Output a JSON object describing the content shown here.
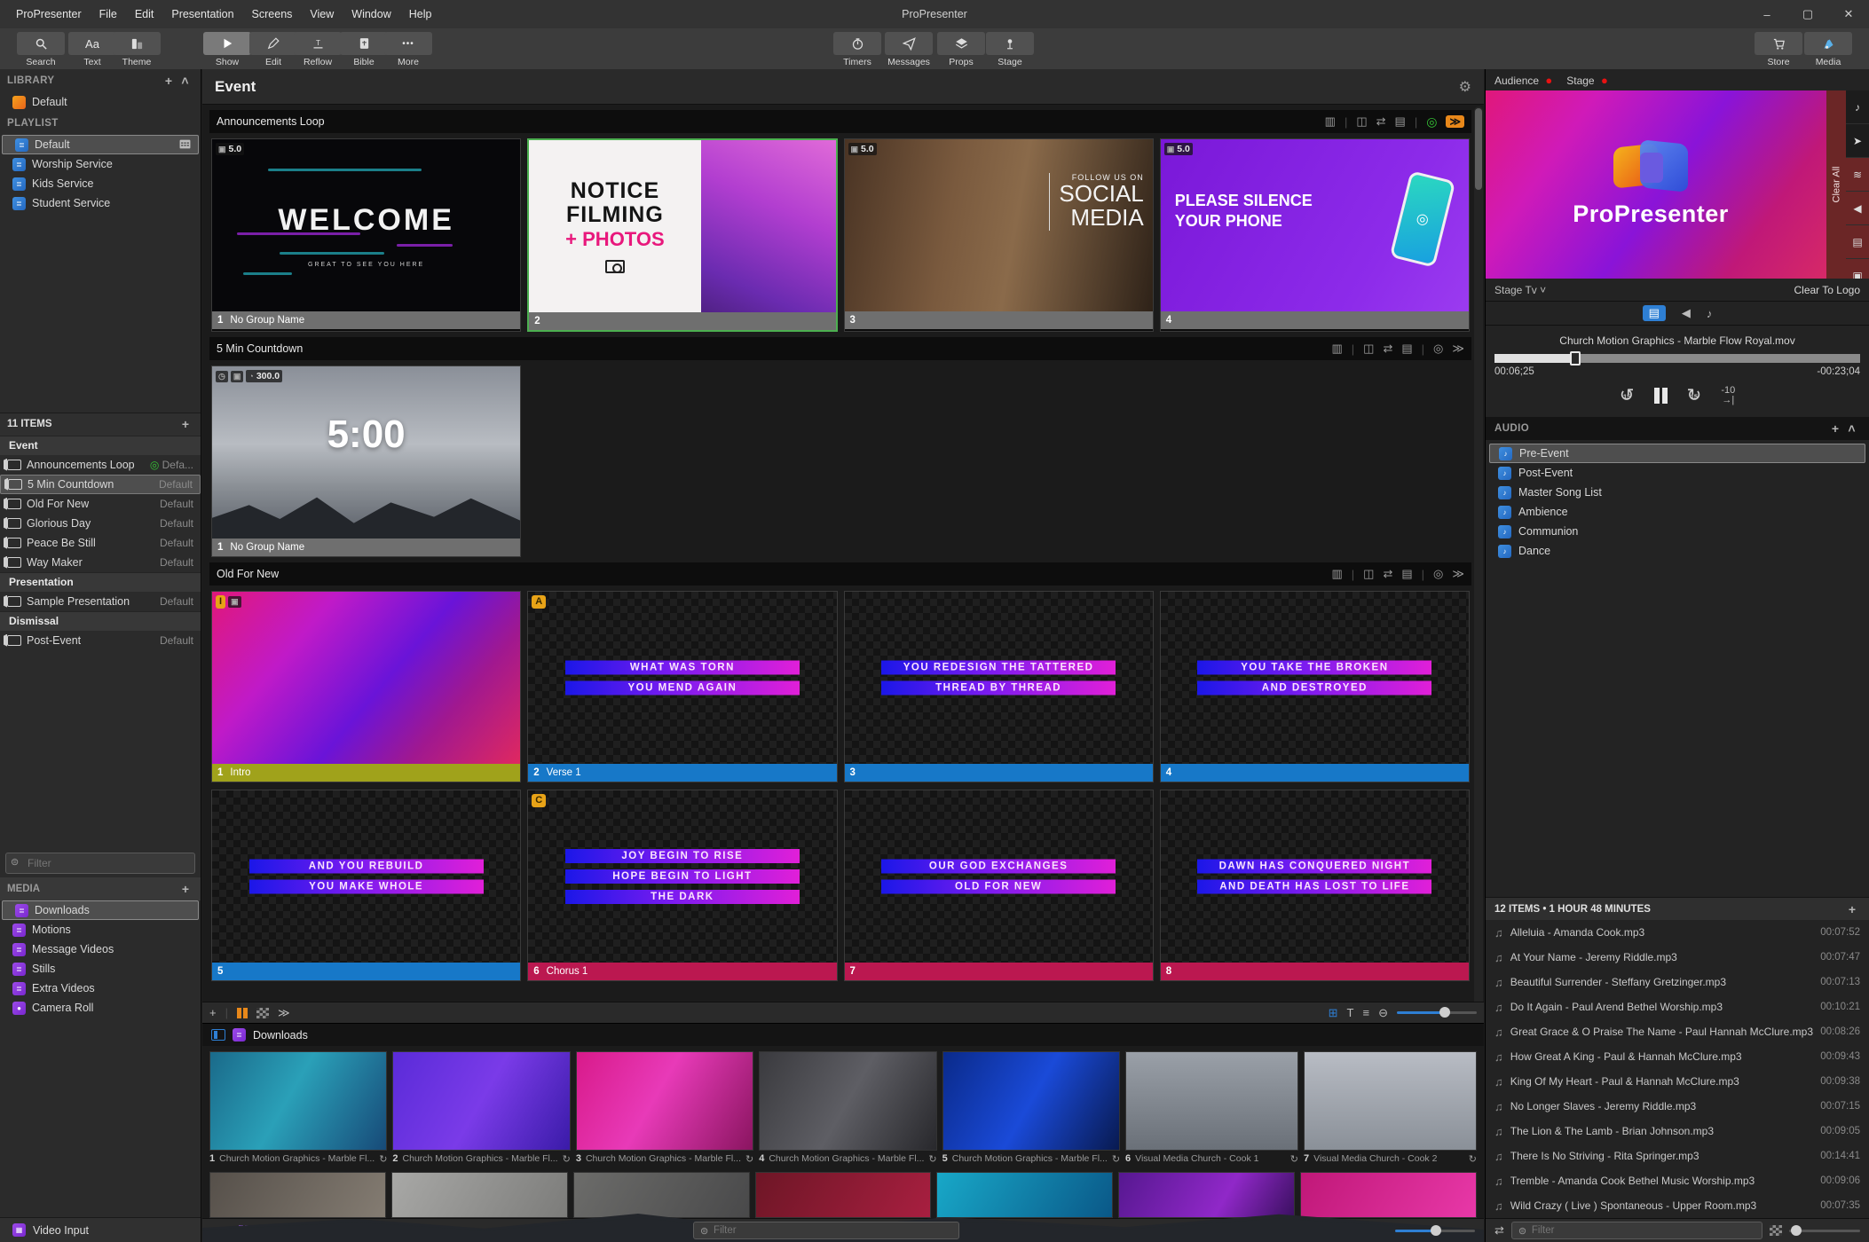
{
  "window": {
    "title": "ProPresenter",
    "minimize": "–",
    "maximize": "▢",
    "close": "✕"
  },
  "menu_bar": {
    "items": [
      "ProPresenter",
      "File",
      "Edit",
      "Presentation",
      "Screens",
      "View",
      "Window",
      "Help"
    ]
  },
  "toolbar": {
    "search": "Search",
    "text": "Text",
    "theme": "Theme",
    "show": "Show",
    "edit": "Edit",
    "reflow": "Reflow",
    "bible": "Bible",
    "more": "More",
    "timers": "Timers",
    "messages": "Messages",
    "props": "Props",
    "stage": "Stage",
    "store": "Store",
    "media": "Media",
    "aa": "Aa"
  },
  "icons": {
    "plus": "+",
    "collapse": "˄",
    "chevron_down": "˅",
    "gear": "⚙",
    "dots": "•••",
    "film": "▥",
    "clipboard": "◫",
    "arrange": "⇄",
    "reflow": "▤",
    "live": "◎",
    "skip": "≫",
    "grid": "⊞",
    "list": "≡",
    "text_tool": "T",
    "circle_dash": "⊖",
    "shuffle": "⇄",
    "record": "●",
    "loop": "↻",
    "back15": "↺",
    "fwd15": "↻",
    "note": "♪",
    "note2": "♫",
    "send": "➤",
    "layers": "≋",
    "megaphone": "◀",
    "slide": "▤",
    "picture": "▣",
    "camera": "▦",
    "filter": "⊜",
    "clock": "◷",
    "globe": "◔",
    "to_end": "→|",
    "sep": "|"
  },
  "library": {
    "header": "LIBRARY",
    "items": [
      {
        "label": "Default"
      }
    ]
  },
  "playlist": {
    "header": "PLAYLIST",
    "items": [
      {
        "label": "Default"
      },
      {
        "label": "Worship Service"
      },
      {
        "label": "Kids Service"
      },
      {
        "label": "Student Service"
      }
    ]
  },
  "items_panel": {
    "header": "11 ITEMS",
    "filter_placeholder": "Filter",
    "groups": [
      {
        "label": "Event",
        "items": [
          {
            "name": "Announcements Loop",
            "meta": "Defa..."
          },
          {
            "name": "5 Min Countdown",
            "meta": "Default"
          },
          {
            "name": "Old For New",
            "meta": "Default"
          },
          {
            "name": "Glorious Day",
            "meta": "Default"
          },
          {
            "name": "Peace Be Still",
            "meta": "Default"
          },
          {
            "name": "Way Maker",
            "meta": "Default"
          }
        ]
      },
      {
        "label": "Presentation",
        "items": [
          {
            "name": "Sample Presentation",
            "meta": "Default"
          }
        ]
      },
      {
        "label": "Dismissal",
        "items": [
          {
            "name": "Post-Event",
            "meta": "Default"
          }
        ]
      }
    ]
  },
  "media_panel": {
    "header": "MEDIA",
    "items": [
      {
        "label": "Downloads"
      },
      {
        "label": "Motions"
      },
      {
        "label": "Message Videos"
      },
      {
        "label": "Stills"
      },
      {
        "label": "Extra Videos"
      },
      {
        "label": "Camera Roll"
      }
    ],
    "video_input": "Video Input"
  },
  "main": {
    "title": "Event",
    "sections": [
      {
        "name": "Announcements Loop",
        "slides": [
          {
            "num": "1",
            "label": "No Group Name",
            "badge": "5.0",
            "title": "WELCOME",
            "subtitle": "GREAT TO SEE YOU HERE"
          },
          {
            "num": "2",
            "label": "",
            "line1": "NOTICE",
            "line2": "FILMING",
            "line3": "+ PHOTOS"
          },
          {
            "num": "3",
            "label": "",
            "badge": "5.0",
            "line1": "FOLLOW US ON",
            "line2": "SOCIAL",
            "line3": "MEDIA"
          },
          {
            "num": "4",
            "label": "",
            "badge": "5.0",
            "line1": "PLEASE SILENCE",
            "line2": "YOUR PHONE"
          }
        ]
      },
      {
        "name": "5 Min Countdown",
        "slides": [
          {
            "num": "1",
            "label": "No Group Name",
            "badge": "300.0",
            "time": "5:00"
          }
        ]
      },
      {
        "name": "Old For New",
        "slides": [
          {
            "num": "1",
            "label": "Intro",
            "badge": "I"
          },
          {
            "num": "2",
            "label": "Verse 1",
            "badge": "A",
            "lines": [
              "WHAT WAS TORN",
              "YOU MEND AGAIN"
            ]
          },
          {
            "num": "3",
            "label": "",
            "lines": [
              "YOU REDESIGN THE TATTERED",
              "THREAD BY THREAD"
            ]
          },
          {
            "num": "4",
            "label": "",
            "lines": [
              "YOU TAKE THE BROKEN",
              "AND DESTROYED"
            ]
          },
          {
            "num": "5",
            "label": "",
            "lines": [
              "AND YOU REBUILD",
              "YOU MAKE WHOLE"
            ]
          },
          {
            "num": "6",
            "label": "Chorus 1",
            "badge": "C",
            "lines": [
              "JOY BEGIN TO RISE",
              "HOPE BEGIN TO LIGHT",
              "THE DARK"
            ]
          },
          {
            "num": "7",
            "label": "",
            "lines": [
              "OUR GOD EXCHANGES",
              "OLD FOR NEW"
            ]
          },
          {
            "num": "8",
            "label": "",
            "lines": [
              "DAWN HAS CONQUERED NIGHT",
              "AND DEATH HAS LOST TO LIFE"
            ]
          }
        ]
      }
    ]
  },
  "media_browser": {
    "title": "Downloads",
    "filter_placeholder": "Filter",
    "row1": [
      {
        "num": "1",
        "caption": "Church Motion Graphics - Marble Fl..."
      },
      {
        "num": "2",
        "caption": "Church Motion Graphics - Marble Fl..."
      },
      {
        "num": "3",
        "caption": "Church Motion Graphics - Marble Fl..."
      },
      {
        "num": "4",
        "caption": "Church Motion Graphics - Marble Fl..."
      },
      {
        "num": "5",
        "caption": "Church Motion Graphics - Marble Fl..."
      },
      {
        "num": "6",
        "caption": "Visual Media Church - Cook 1"
      },
      {
        "num": "7",
        "caption": "Visual Media Church - Cook 2"
      }
    ]
  },
  "right_panel": {
    "audience_label": "Audience",
    "stage_label": "Stage",
    "logo_text": "ProPresenter",
    "clear_all": "Clear All",
    "stage_selector": "Stage Tv",
    "clear_to_logo": "Clear To Logo",
    "now_playing": "Church Motion Graphics - Marble Flow Royal.mov",
    "elapsed": "00:06;25",
    "remaining": "-00:23;04",
    "skip_back": "15",
    "skip_fwd": "15",
    "minus10": "-10",
    "audio": {
      "header": "AUDIO",
      "bins": [
        {
          "label": "Pre-Event"
        },
        {
          "label": "Post-Event"
        },
        {
          "label": "Master Song List"
        },
        {
          "label": "Ambience"
        },
        {
          "label": "Communion"
        },
        {
          "label": "Dance"
        }
      ]
    },
    "audio_items": {
      "header": "12 ITEMS • 1 HOUR 48 MINUTES",
      "filter_placeholder": "Filter",
      "files": [
        {
          "name": "Alleluia - Amanda Cook.mp3",
          "duration": "00:07:52"
        },
        {
          "name": "At Your Name - Jeremy Riddle.mp3",
          "duration": "00:07:47"
        },
        {
          "name": "Beautiful Surrender - Steffany Gretzinger.mp3",
          "duration": "00:07:13"
        },
        {
          "name": "Do It Again - Paul Arend  Bethel Worship.mp3",
          "duration": "00:10:21"
        },
        {
          "name": "Great Grace & O Praise The Name - Paul  Hannah McClure.mp3",
          "duration": "00:08:26"
        },
        {
          "name": "How Great A King - Paul & Hannah McClure.mp3",
          "duration": "00:09:43"
        },
        {
          "name": "King Of My Heart - Paul & Hannah McClure.mp3",
          "duration": "00:09:38"
        },
        {
          "name": "No Longer Slaves - Jeremy Riddle.mp3",
          "duration": "00:07:15"
        },
        {
          "name": "The Lion & The Lamb - Brian Johnson.mp3",
          "duration": "00:09:05"
        },
        {
          "name": "There Is No Striving - Rita Springer.mp3",
          "duration": "00:14:41"
        },
        {
          "name": "Tremble - Amanda Cook  Bethel Music Worship.mp3",
          "duration": "00:09:06"
        },
        {
          "name": "Wild  Crazy ( Live )  Spontaneous  - Upper Room.mp3",
          "duration": "00:07:35"
        }
      ]
    }
  },
  "colors": {
    "accent_blue": "#2e7fd4",
    "selected_green": "#4caf50",
    "record_red": "#e81212",
    "live_green": "#35c135",
    "skip_orange": "#e8881a",
    "badge_orange": "#e8a317",
    "footer_gray": "#6f6f6f",
    "footer_blue": "#1778c8",
    "footer_olive": "#a0a21b",
    "footer_crimson": "#bb1850",
    "clear_strip_red": "#6b2626"
  }
}
